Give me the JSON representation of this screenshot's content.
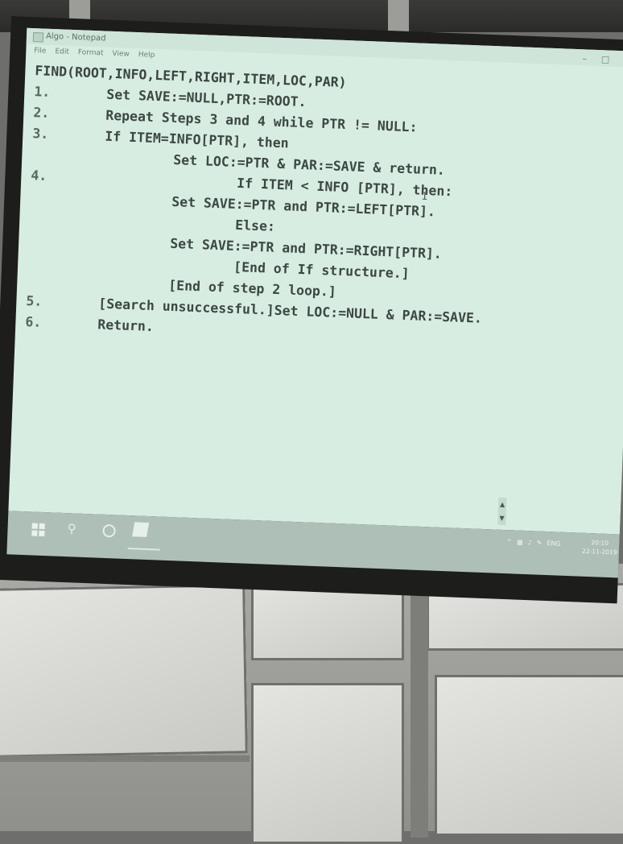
{
  "window": {
    "title": "Algo - Notepad",
    "controls": {
      "minimize": "–",
      "maximize": "□",
      "close": "✕"
    }
  },
  "menu": [
    "File",
    "Edit",
    "Format",
    "View",
    "Help"
  ],
  "editor": {
    "header": "FIND(ROOT,INFO,LEFT,RIGHT,ITEM,LOC,PAR)",
    "lines": [
      {
        "num": "1.",
        "indent": 1,
        "text": "Set SAVE:=NULL,PTR:=ROOT."
      },
      {
        "num": "2.",
        "indent": 1,
        "text": "Repeat Steps 3 and 4 while PTR != NULL:"
      },
      {
        "num": "3.",
        "indent": 2,
        "text": "If ITEM=INFO[PTR], then"
      },
      {
        "num": "",
        "indent": 3,
        "text": "Set LOC:=PTR & PAR:=SAVE & return."
      },
      {
        "num": "4.",
        "indent": 2,
        "text": "If ITEM < INFO [PTR], then:"
      },
      {
        "num": "",
        "indent": 3,
        "text": "Set SAVE:=PTR and PTR:=LEFT[PTR]."
      },
      {
        "num": "",
        "indent": 2,
        "text": "Else:"
      },
      {
        "num": "",
        "indent": 3,
        "text": "Set SAVE:=PTR and PTR:=RIGHT[PTR]."
      },
      {
        "num": "",
        "indent": 2,
        "text": "[End of If structure.]"
      },
      {
        "num": "",
        "indent": 1,
        "text": "[End of step 2 loop.]"
      },
      {
        "num": "5.",
        "indent": 1,
        "text": "[Search unsuccessful.]Set LOC:=NULL & PAR:=SAVE."
      },
      {
        "num": "6.",
        "indent": 1,
        "text": "Return."
      }
    ],
    "text_cursor": "I"
  },
  "scrollbar": {
    "up": "▲",
    "down": "▼"
  },
  "taskbar": {
    "tray_icons": [
      "chevron-up-icon",
      "network-icon",
      "volume-icon",
      "pen-icon"
    ],
    "language": "ENG",
    "time": "20:10",
    "date": "22-11-2019"
  }
}
